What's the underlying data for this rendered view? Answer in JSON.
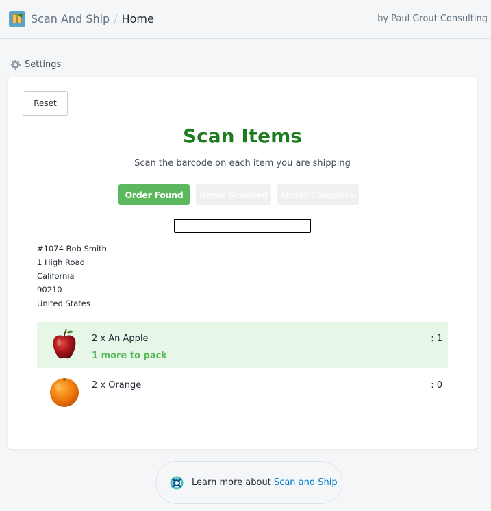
{
  "header": {
    "app_name": "Scan And Ship",
    "separator": "/",
    "page": "Home",
    "byline": "by Paul Grout Consulting"
  },
  "settings_link": {
    "label": "Settings",
    "icon": "gear-icon"
  },
  "card": {
    "reset_label": "Reset",
    "title": "Scan Items",
    "subtitle": "Scan the barcode on each item you are shipping",
    "steps": [
      {
        "label": "Order Found",
        "state": "active"
      },
      {
        "label": "Items Scanned",
        "state": "inactive"
      },
      {
        "label": "Order Complete",
        "state": "inactive"
      }
    ],
    "scan_input": {
      "value": "",
      "placeholder": ""
    },
    "address": {
      "line1": "#1074 Bob Smith",
      "line2": "1 High Road",
      "line3": "California",
      "line4": "90210",
      "line5": "United States"
    },
    "items": [
      {
        "name": "2 x An Apple",
        "count": ": 1",
        "status": "1 more to pack",
        "image": "apple-image",
        "highlight": true
      },
      {
        "name": "2 x Orange",
        "count": ": 0",
        "status": "",
        "image": "orange-image",
        "highlight": false
      }
    ]
  },
  "footer": {
    "prefix": "Learn more about ",
    "link_label": "Scan and Ship",
    "icon": "lifebuoy-icon"
  },
  "colors": {
    "title_green": "#1e7b1f",
    "step_active": "#5cb85c",
    "step_inactive": "#eef0f1",
    "row_highlight": "#e7f7e7",
    "link_blue": "#007ace"
  }
}
